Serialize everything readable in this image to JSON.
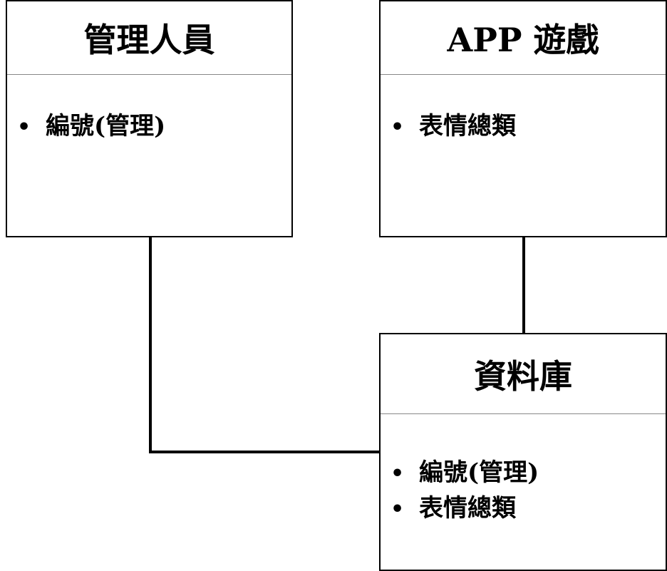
{
  "boxes": {
    "admin": {
      "title": "管理人員",
      "items": [
        "編號(管理)"
      ]
    },
    "app": {
      "title": "APP 遊戲",
      "items": [
        "表情總類"
      ]
    },
    "db": {
      "title": "資料庫",
      "items": [
        "編號(管理)",
        "表情總類"
      ]
    }
  },
  "bullet": "•",
  "colors": {
    "line": "#000000",
    "divider": "#888888",
    "background": "#ffffff"
  }
}
